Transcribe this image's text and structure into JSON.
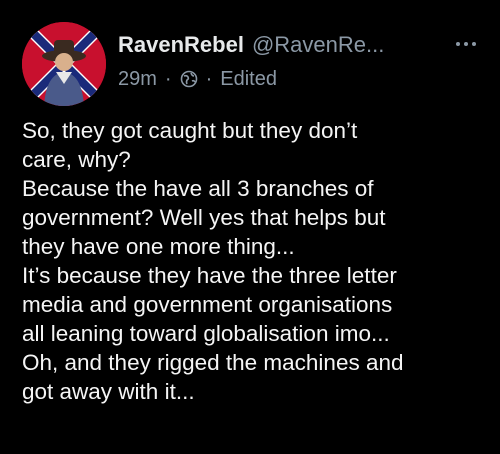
{
  "post": {
    "author": {
      "display_name": "RavenRebel",
      "handle": "@RavenRe..."
    },
    "meta": {
      "time": "29m",
      "separator": "·",
      "edited": "Edited"
    },
    "body_lines": [
      "So, they got caught but they don’t",
      "care, why?",
      "Because the have all 3 branches of",
      "government? Well yes that helps but",
      "they have one more thing...",
      "It’s because they have the three letter",
      "media and government organisations",
      "all leaning toward globalisation imo...",
      "Oh, and they rigged the machines and",
      "got away with it..."
    ]
  },
  "icons": {
    "more": "more-horizontal-icon",
    "audience": "globe-icon"
  },
  "colors": {
    "background": "#000000",
    "text": "#e7e9ea",
    "secondary": "#8b98a5",
    "avatar_red": "#c8102e"
  }
}
